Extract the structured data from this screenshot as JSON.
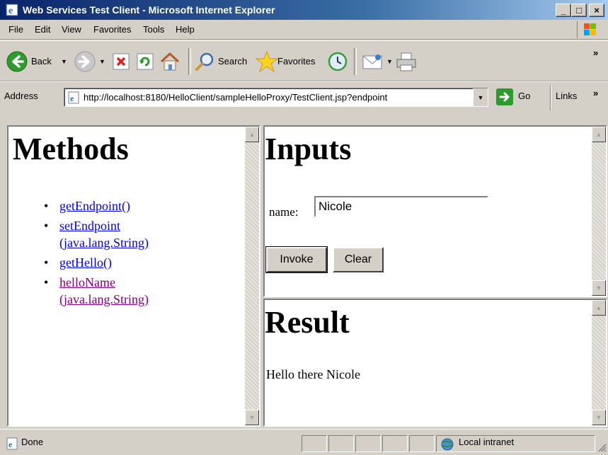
{
  "window": {
    "title": "Web Services Test Client - Microsoft Internet Explorer",
    "min_label": "_",
    "max_label": "□",
    "close_label": "×"
  },
  "menu": [
    "File",
    "Edit",
    "View",
    "Favorites",
    "Tools",
    "Help"
  ],
  "toolbar": {
    "back_label": "Back",
    "search_label": "Search",
    "favorites_label": "Favorites"
  },
  "address": {
    "label": "Address",
    "url": "http://localhost:8180/HelloClient/sampleHelloProxy/TestClient.jsp?endpoint",
    "go_label": "Go",
    "links_label": "Links"
  },
  "methods": {
    "heading": "Methods",
    "items": [
      {
        "line1": "getEndpoint()",
        "line2": ""
      },
      {
        "line1": "setEndpoint",
        "line2": "(java.lang.String)"
      },
      {
        "line1": "getHello()",
        "line2": ""
      },
      {
        "line1": "helloName",
        "line2": "(java.lang.String)"
      }
    ]
  },
  "inputs": {
    "heading": "Inputs",
    "name_label": "name:",
    "name_value": "Nicole",
    "invoke_label": "Invoke",
    "clear_label": "Clear"
  },
  "result": {
    "heading": "Result",
    "text": "Hello there Nicole"
  },
  "status": {
    "text": "Done",
    "zone": "Local intranet"
  },
  "colors": {
    "link": "#0000ee",
    "visited_link": "#800080",
    "chrome": "#d4d0c8",
    "titlebar": "#0a246a"
  }
}
